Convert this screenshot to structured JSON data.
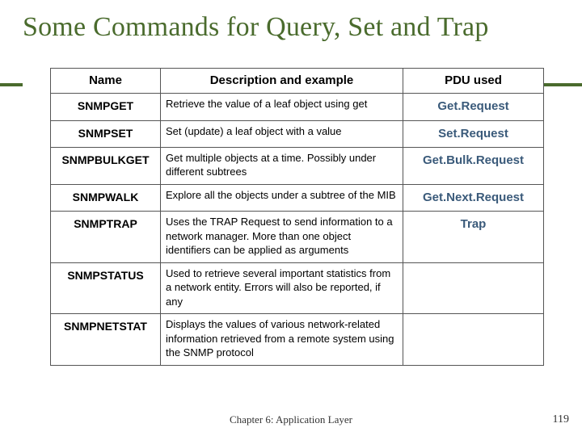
{
  "title": "Some Commands for Query, Set and Trap",
  "footer": {
    "center": "Chapter 6: Application Layer",
    "page": "119"
  },
  "table": {
    "headers": {
      "name": "Name",
      "desc": "Description and example",
      "pdu": "PDU used"
    },
    "rows": [
      {
        "name": "SNMPGET",
        "desc": "Retrieve the value of a leaf object using get",
        "pdu": "Get.Request"
      },
      {
        "name": "SNMPSET",
        "desc": "Set (update) a leaf object with a value",
        "pdu": "Set.Request"
      },
      {
        "name": "SNMPBULKGET",
        "desc": "Get multiple objects at a time. Possibly under different subtrees",
        "pdu": "Get.Bulk.Request"
      },
      {
        "name": "SNMPWALK",
        "desc": "Explore all the objects under a subtree of the MIB",
        "pdu": "Get.Next.Request"
      },
      {
        "name": "SNMPTRAP",
        "desc": "Uses the TRAP Request to send information to a network manager. More than one object identifiers can be applied as arguments",
        "pdu": "Trap"
      },
      {
        "name": "SNMPSTATUS",
        "desc": "Used to retrieve several important statistics from a network entity. Errors will also be reported, if any",
        "pdu": ""
      },
      {
        "name": "SNMPNETSTAT",
        "desc": "Displays the values of various network-related information retrieved from a remote system using the SNMP protocol",
        "pdu": ""
      }
    ]
  }
}
